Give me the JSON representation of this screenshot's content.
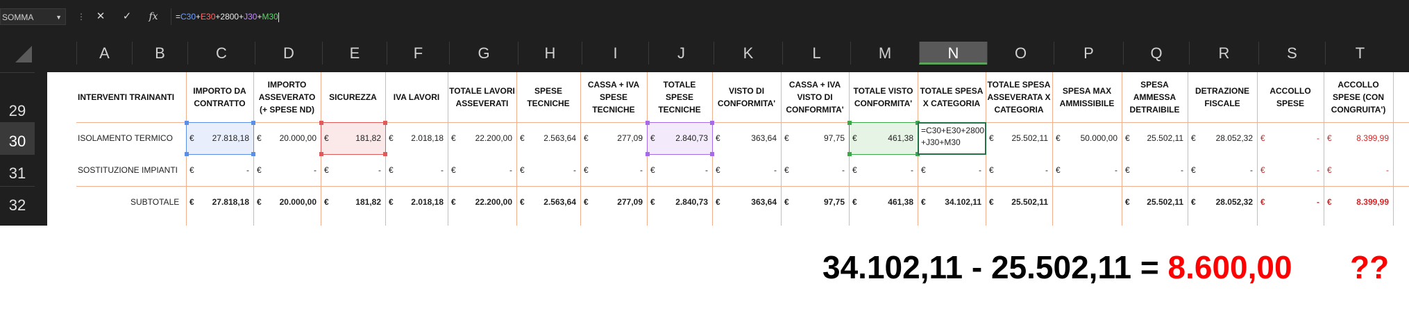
{
  "formula_bar": {
    "name_box": "SOMMA",
    "cancel_icon": "✕",
    "confirm_icon": "✓",
    "fx_label": "fx",
    "formula_parts": [
      "=",
      "C30",
      "+",
      "E30",
      "+2800+",
      "J30",
      "+",
      "M30"
    ]
  },
  "columns": [
    "A",
    "B",
    "C",
    "D",
    "E",
    "F",
    "G",
    "H",
    "I",
    "J",
    "K",
    "L",
    "M",
    "N",
    "O",
    "P",
    "Q",
    "R",
    "S",
    "T"
  ],
  "active_column": "N",
  "rows": [
    "29",
    "30",
    "31",
    "32"
  ],
  "active_row": "30",
  "headers": {
    "a": "INTERVENTI TRAINANTI",
    "c": "IMPORTO DA CONTRATTO",
    "d": "IMPORTO ASSEVERATO (+ SPESE ND)",
    "e": "SICUREZZA",
    "f": "IVA LAVORI",
    "g": "TOTALE LAVORI ASSEVERATI",
    "h": "SPESE TECNICHE",
    "i": "CASSA + IVA SPESE TECNICHE",
    "j": "TOTALE SPESE TECNICHE",
    "k": "VISTO DI CONFORMITA'",
    "l": "CASSA + IVA VISTO DI CONFORMITA'",
    "m": "TOTALE VISTO CONFORMITA'",
    "n": "TOTALE SPESA X CATEGORIA",
    "o": "TOTALE SPESA ASSEVERATA X CATEGORIA",
    "p": "SPESA MAX AMMISSIBILE",
    "q": "SPESA AMMESSA DETRAIBILE",
    "r": "DETRAZIONE FISCALE",
    "s": "ACCOLLO SPESE",
    "t": "ACCOLLO SPESE (CON CONGRUITA')"
  },
  "currency": "€",
  "row30": {
    "label": "ISOLAMENTO TERMICO",
    "c": "27.818,18",
    "d": "20.000,00",
    "e": "181,82",
    "f": "2.018,18",
    "g": "22.200,00",
    "h": "2.563,64",
    "i": "277,09",
    "j": "2.840,73",
    "k": "363,64",
    "l": "97,75",
    "m": "461,38",
    "n_edit": "=C30+E30+2800 +J30+M30",
    "o": "25.502,11",
    "p": "50.000,00",
    "q": "25.502,11",
    "r": "28.052,32",
    "s": "-",
    "t": "8.399,99"
  },
  "row31": {
    "label": "SOSTITUZIONE IMPIANTI",
    "dash": "-"
  },
  "row32": {
    "label": "SUBTOTALE",
    "c": "27.818,18",
    "d": "20.000,00",
    "e": "181,82",
    "f": "2.018,18",
    "g": "22.200,00",
    "h": "2.563,64",
    "i": "277,09",
    "j": "2.840,73",
    "k": "363,64",
    "l": "97,75",
    "m": "461,38",
    "n": "34.102,11",
    "o": "25.502,11",
    "q": "25.502,11",
    "r": "28.052,32",
    "s": "-",
    "t": "8.399,99"
  },
  "annotation": {
    "expression": "34.102,11 - 25.502,11 = ",
    "result": "8.600,00",
    "question": "??"
  },
  "colors": {
    "ref_blue": "#6fa0ff",
    "ref_red": "#ff6b6b",
    "ref_purple": "#c58cff",
    "ref_green": "#5fd36b",
    "excel_green": "#217346",
    "negative_red": "#e02020"
  }
}
